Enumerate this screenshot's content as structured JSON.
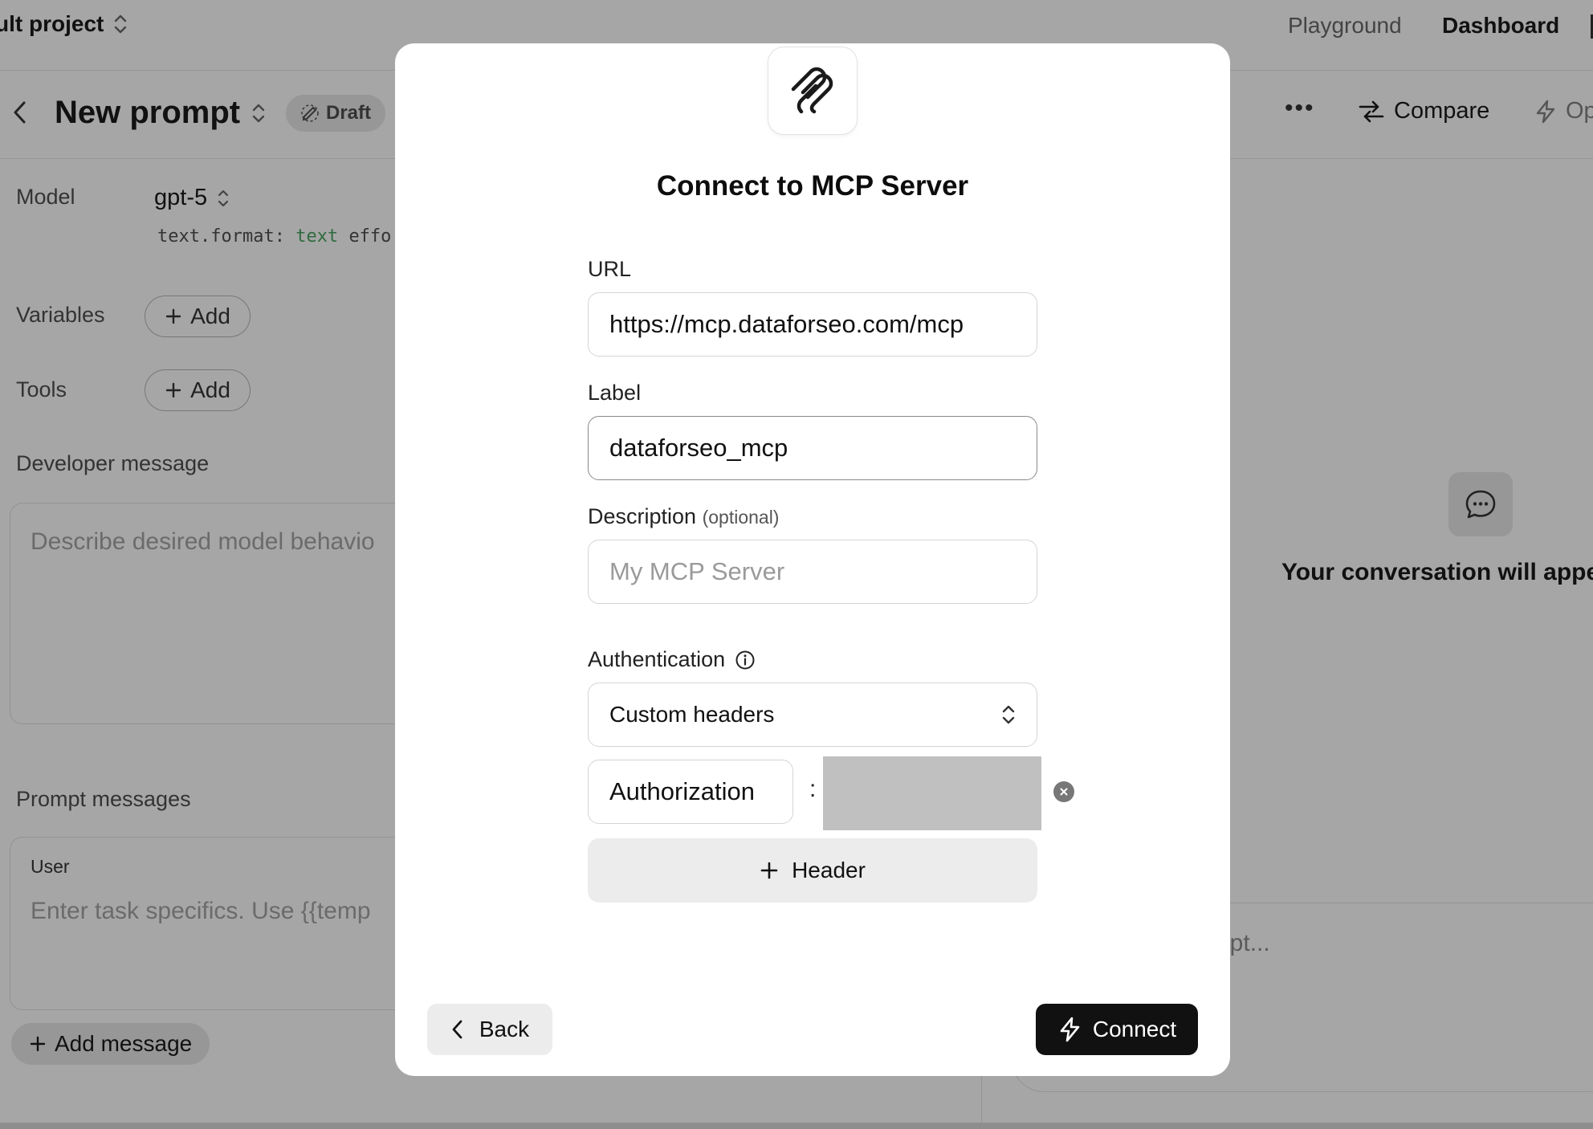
{
  "topbar": {
    "project_name": "ult project",
    "nav": [
      {
        "label": "Playground",
        "active": false
      },
      {
        "label": "Dashboard",
        "active": true
      }
    ]
  },
  "prompt_header": {
    "title": "New prompt",
    "status_badge": "Draft",
    "actions": {
      "compare": "Compare",
      "optimize": "Op"
    }
  },
  "left_panel": {
    "model_label": "Model",
    "model_value": "gpt-5",
    "model_meta_key": "text.format:",
    "model_meta_value": "text",
    "model_meta_more": "effo",
    "variables_label": "Variables",
    "tools_label": "Tools",
    "add_label": "Add",
    "developer_message_label": "Developer message",
    "developer_message_placeholder": "Describe desired model behavio",
    "prompt_messages_label": "Prompt messages",
    "user_role": "User",
    "user_placeholder": "Enter task specifics. Use {{temp",
    "add_message": "Add message"
  },
  "right_panel": {
    "empty_state": "Your conversation will appe",
    "chat_placeholder": "ompt..."
  },
  "modal": {
    "title": "Connect to MCP Server",
    "url": {
      "label": "URL",
      "value": "https://mcp.dataforseo.com/mcp"
    },
    "label_field": {
      "label": "Label",
      "value": "dataforseo_mcp"
    },
    "description": {
      "label": "Description",
      "optional": "(optional)",
      "placeholder": "My MCP Server",
      "value": ""
    },
    "authentication": {
      "label": "Authentication",
      "selected": "Custom headers"
    },
    "headers": [
      {
        "key": "Authorization",
        "separator": ":"
      }
    ],
    "add_header": "Header",
    "back": "Back",
    "connect": "Connect"
  },
  "colors": {
    "overlay_bg": "#a6a6a6",
    "modal_bg": "#ffffff",
    "primary_button": "#111111",
    "secondary_button": "#ececec",
    "field_border": "#d5d5d5"
  }
}
